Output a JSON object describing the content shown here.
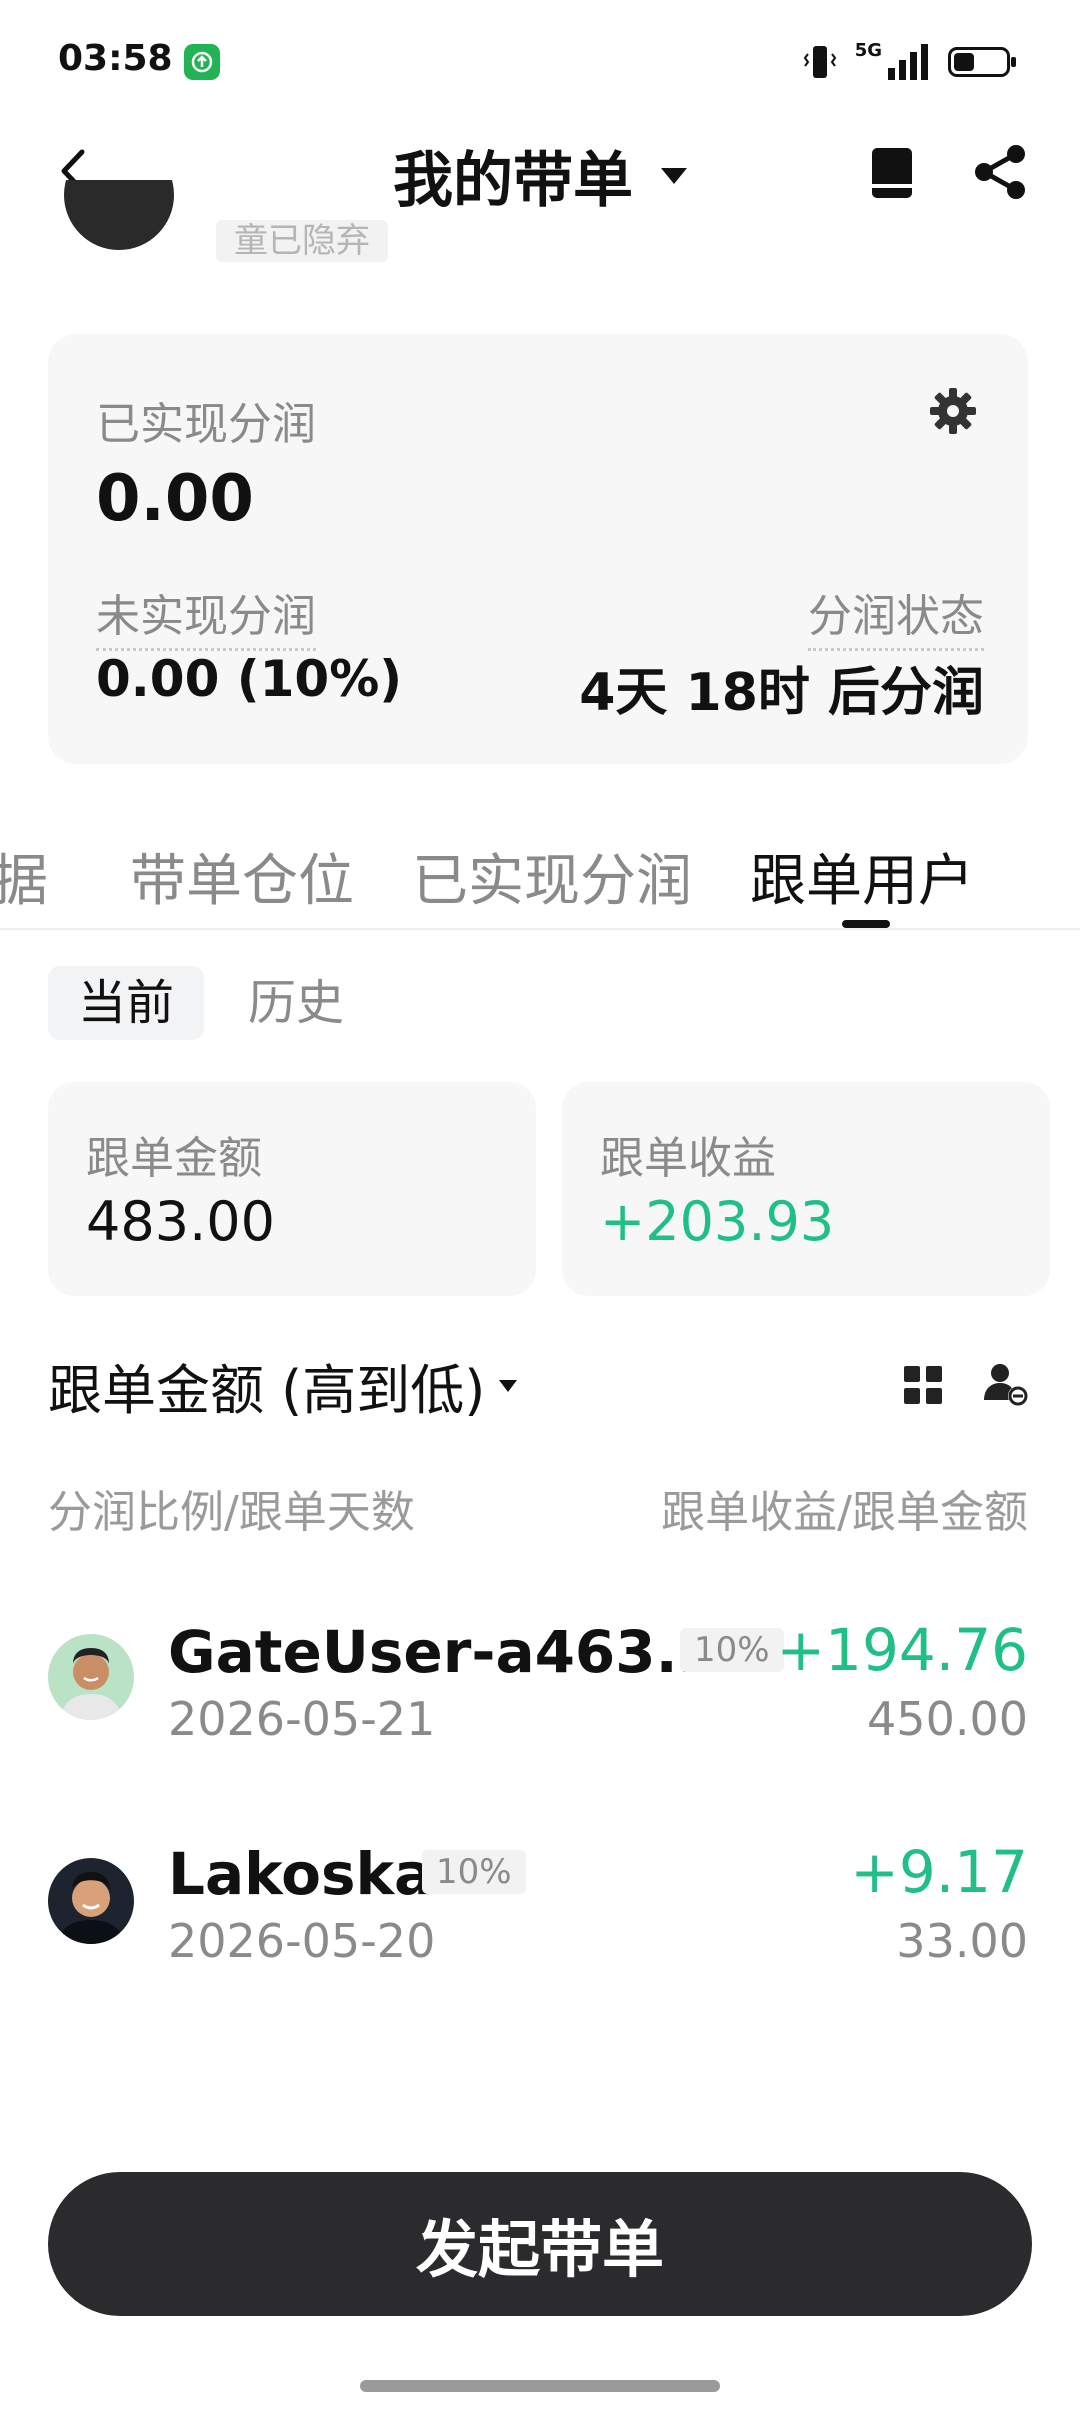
{
  "status_bar": {
    "time": "03:58",
    "network": "5G"
  },
  "nav": {
    "title": "我的带单"
  },
  "profile": {
    "hidden_tag": "童已隐弃"
  },
  "profit_card": {
    "realized_label": "已实现分润",
    "realized_value": "0.00",
    "unrealized_label": "未实现分润",
    "unrealized_value": "0.00 (10%)",
    "status_label": "分润状态",
    "status_value": "4天 18时 后分润"
  },
  "tabs": [
    {
      "label": "数据"
    },
    {
      "label": "带单仓位"
    },
    {
      "label": "已实现分润"
    },
    {
      "label": "跟单用户"
    }
  ],
  "subtabs": {
    "current": "当前",
    "history": "历史"
  },
  "stats": {
    "amount_label": "跟单金额",
    "amount_value": "483.00",
    "profit_label": "跟单收益",
    "profit_value": "+203.93"
  },
  "sort": {
    "label": "跟单金额 (高到低)"
  },
  "columns": {
    "left": "分润比例/跟单天数",
    "right": "跟单收益/跟单金额"
  },
  "followers": [
    {
      "name": "GateUser-a463...",
      "badge": "10%",
      "date": "2026-05-21",
      "profit": "+194.76",
      "amount": "450.00"
    },
    {
      "name": "Lakoska",
      "badge": "10%",
      "date": "2026-05-20",
      "profit": "+9.17",
      "amount": "33.00"
    }
  ],
  "launch_button": "发起带单",
  "colors": {
    "accent_green": "#1fbf85",
    "button_dark": "#2b2b2d"
  }
}
